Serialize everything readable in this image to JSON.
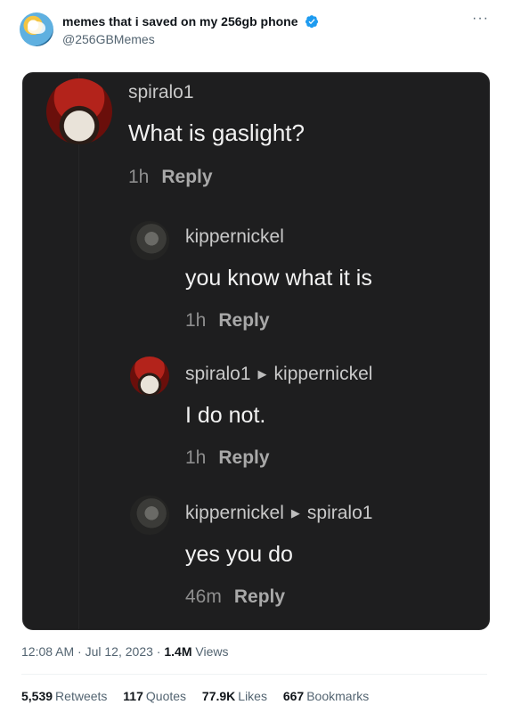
{
  "author": {
    "display_name": "memes that i saved on my 256gb phone",
    "handle": "@256GBMemes",
    "more_label": "···",
    "verified_color": "#1d9bf0"
  },
  "media": {
    "comments": [
      {
        "user": "spiralo1",
        "reply_to": "",
        "text": "What is gaslight?",
        "time": "1h",
        "reply_label": "Reply"
      },
      {
        "user": "kippernickel",
        "reply_to": "",
        "text": "you know what it is",
        "time": "1h",
        "reply_label": "Reply"
      },
      {
        "user": "spiralo1",
        "reply_to": "kippernickel",
        "text": "I do not.",
        "time": "1h",
        "reply_label": "Reply"
      },
      {
        "user": "kippernickel",
        "reply_to": "spiralo1",
        "text": "yes you do",
        "time": "46m",
        "reply_label": "Reply"
      }
    ]
  },
  "meta": {
    "time": "12:08 AM",
    "date": "Jul 12, 2023",
    "views_count": "1.4M",
    "views_label": "Views",
    "separator": "·"
  },
  "stats": {
    "retweets_count": "5,539",
    "retweets_label": "Retweets",
    "quotes_count": "117",
    "quotes_label": "Quotes",
    "likes_count": "77.9K",
    "likes_label": "Likes",
    "bookmarks_count": "667",
    "bookmarks_label": "Bookmarks"
  }
}
